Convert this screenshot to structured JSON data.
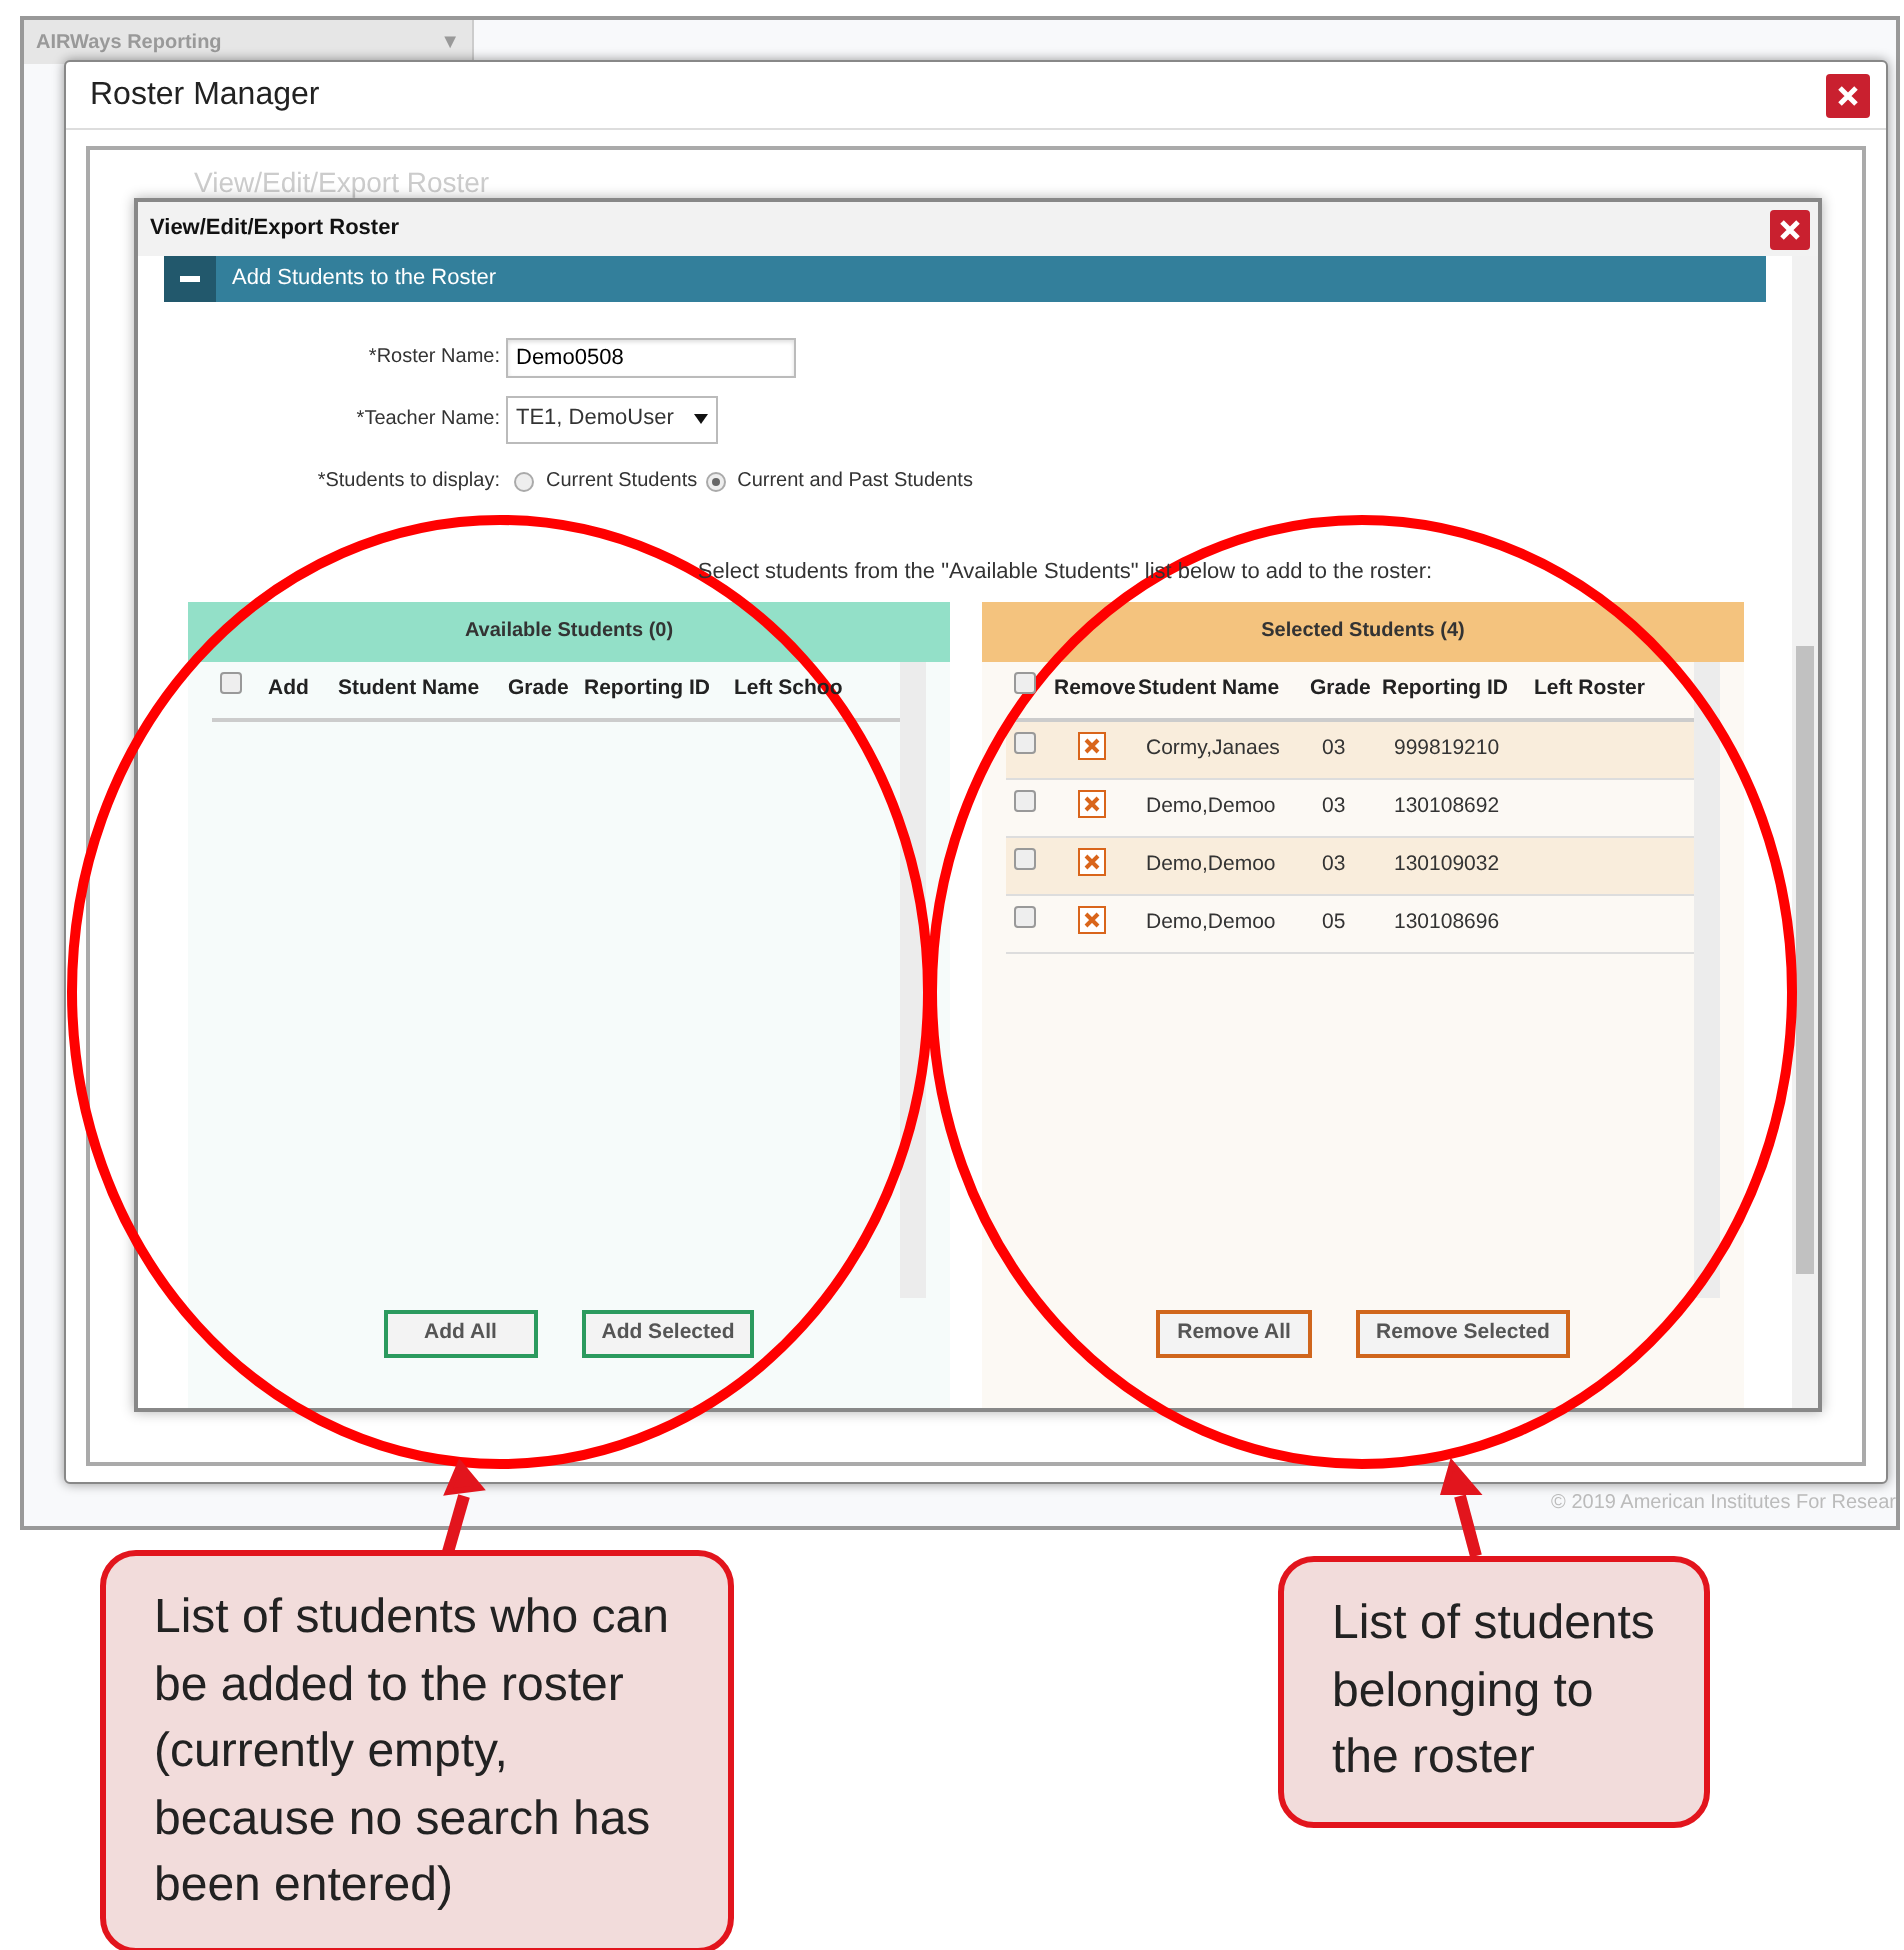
{
  "app": {
    "title": "AIRWays Reporting",
    "dropdown_icon": "▼",
    "footer": "© 2019 American Institutes For Resear",
    "background_heading": "View/Edit/Export Roster"
  },
  "roster_manager": {
    "title": "Roster Manager"
  },
  "dialog": {
    "title": "View/Edit/Export Roster",
    "section": {
      "title": "Add Students to the Roster",
      "expanded": true
    },
    "fields": [
      {
        "kind": "text",
        "label": "*Roster Name:",
        "value": "Demo0508"
      },
      {
        "kind": "select",
        "label": "*Teacher Name:",
        "value": "TE1, DemoUser"
      },
      {
        "kind": "radio",
        "label": "*Students to display:",
        "options": [
          {
            "label": "Current Students",
            "selected": false
          },
          {
            "label": "Current and Past Students",
            "selected": true
          }
        ]
      }
    ],
    "instruction": "Select students from the \"Available Students\" list below to add to the roster:",
    "panels": [
      {
        "kind": "available",
        "title": "Available Students (0)",
        "select_all_checked": false,
        "columns": [
          "Add",
          "Student Name",
          "Grade",
          "Reporting ID",
          "Left Schoo"
        ],
        "buttons": [
          "Add All",
          "Add Selected"
        ]
      },
      {
        "kind": "selected",
        "title": "Selected Students (4)",
        "select_all_checked": false,
        "columns": [
          "Remove",
          "Student Name",
          "Grade",
          "Reporting ID",
          "Left Roster"
        ],
        "rows": [
          {
            "name": "Cormy,Janaes",
            "grade": "03",
            "reporting_id": "999819210",
            "checked": false
          },
          {
            "name": "Demo,Demoo",
            "grade": "03",
            "reporting_id": "130108692",
            "checked": false
          },
          {
            "name": "Demo,Demoo",
            "grade": "03",
            "reporting_id": "130109032",
            "checked": false
          },
          {
            "name": "Demo,Demoo",
            "grade": "05",
            "reporting_id": "130108696",
            "checked": false
          }
        ],
        "buttons": [
          "Remove All",
          "Remove Selected"
        ]
      }
    ]
  },
  "callouts": [
    {
      "text": "List of students who can be added to the roster (currently empty, because no search has been entered)"
    },
    {
      "text": "List of students belonging to the roster"
    }
  ]
}
